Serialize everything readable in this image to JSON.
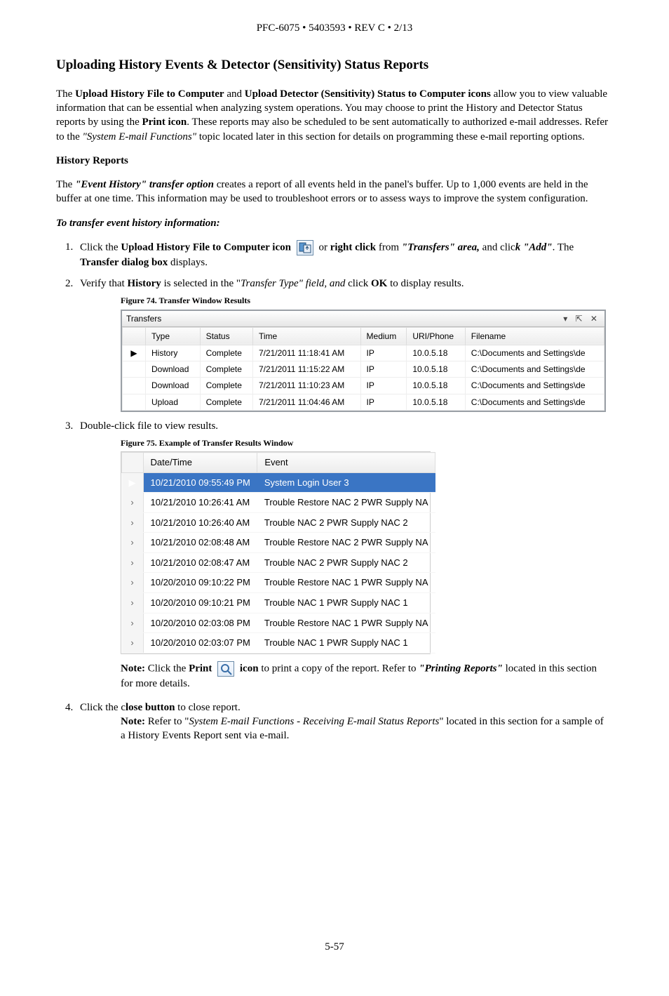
{
  "header_line": "PFC-6075 • 5403593 • REV C • 2/13",
  "title": "Uploading History Events & Detector (Sensitivity) Status Reports",
  "intro": {
    "p1_a": "The ",
    "p1_b": "Upload History File to Computer",
    "p1_c": " and ",
    "p1_d": "Upload Detector (Sensitivity) Status to Computer icons",
    "p1_e": " allow you to view valuable information that can be essential when analyzing system operations. You may choose to print the History and Detector Status reports by using the ",
    "p1_f": "Print icon",
    "p1_g": ". These reports may also be scheduled to be sent automatically to authorized e-mail addresses. Refer to the ",
    "p1_h": "\"System E-mail Functions\"",
    "p1_i": " topic located later in this section for details on programming these e-mail reporting options."
  },
  "history_heading": "History Reports",
  "hist_p": {
    "a": "The ",
    "b": "\"Event History\" transfer option",
    "c": " creates a report of all events held in the panel's buffer. Up to 1,000 events are held in the buffer at one time. This information may be used to troubleshoot errors or to assess ways to improve the system configuration."
  },
  "transfer_heading": "To transfer event history information:",
  "step1": {
    "a": "Click the ",
    "b": "Upload History File to Computer icon",
    "c": "  or ",
    "d": "right click",
    "e": " from ",
    "f": "\"Transfers\" area,",
    "g": " and clic",
    "h": "k \"Add\"",
    "i": ". The ",
    "j": "Transfer dialog box",
    "k": " displays."
  },
  "step2": {
    "a": "Verify that ",
    "b": "History",
    "c": " is selected  in the \"",
    "d": "Transfer Type\" field, and ",
    "e": "click ",
    "f": "OK",
    "g": " to display results."
  },
  "fig74": "Figure 74. Transfer Window Results",
  "transfers": {
    "title": "Transfers",
    "headers": {
      "type": "Type",
      "status": "Status",
      "time": "Time",
      "medium": "Medium",
      "uri": "URI/Phone",
      "file": "Filename"
    },
    "rows": [
      {
        "ptr": "▶",
        "type": "History",
        "status": "Complete",
        "time": "7/21/2011 11:18:41 AM",
        "medium": "IP",
        "uri": "10.0.5.18",
        "file": "C:\\Documents and Settings\\de"
      },
      {
        "ptr": "",
        "type": "Download",
        "status": "Complete",
        "time": "7/21/2011 11:15:22 AM",
        "medium": "IP",
        "uri": "10.0.5.18",
        "file": "C:\\Documents and Settings\\de"
      },
      {
        "ptr": "",
        "type": "Download",
        "status": "Complete",
        "time": "7/21/2011 11:10:23 AM",
        "medium": "IP",
        "uri": "10.0.5.18",
        "file": "C:\\Documents and Settings\\de"
      },
      {
        "ptr": "",
        "type": "Upload",
        "status": "Complete",
        "time": "7/21/2011 11:04:46 AM",
        "medium": "IP",
        "uri": "10.0.5.18",
        "file": "C:\\Documents and Settings\\de"
      }
    ]
  },
  "step3": "Double-click file to view results.",
  "fig75": "Figure 75. Example of Transfer Results Window",
  "results": {
    "headers": {
      "dt": "Date/Time",
      "ev": "Event"
    },
    "rows": [
      {
        "sel": true,
        "dt": "10/21/2010 09:55:49 PM",
        "ev": "System Login User 3"
      },
      {
        "sel": false,
        "dt": "10/21/2010 10:26:41 AM",
        "ev": "Trouble Restore NAC 2 PWR Supply NA"
      },
      {
        "sel": false,
        "dt": "10/21/2010 10:26:40 AM",
        "ev": "Trouble NAC 2 PWR Supply NAC 2"
      },
      {
        "sel": false,
        "dt": "10/21/2010 02:08:48 AM",
        "ev": "Trouble Restore NAC 2 PWR Supply NA"
      },
      {
        "sel": false,
        "dt": "10/21/2010 02:08:47 AM",
        "ev": "Trouble NAC 2 PWR Supply NAC 2"
      },
      {
        "sel": false,
        "dt": "10/20/2010 09:10:22 PM",
        "ev": "Trouble Restore NAC 1 PWR Supply NA"
      },
      {
        "sel": false,
        "dt": "10/20/2010 09:10:21 PM",
        "ev": "Trouble NAC 1 PWR Supply NAC 1"
      },
      {
        "sel": false,
        "dt": "10/20/2010 02:03:08 PM",
        "ev": "Trouble Restore NAC 1 PWR Supply NA"
      },
      {
        "sel": false,
        "dt": "10/20/2010 02:03:07 PM",
        "ev": "Trouble NAC 1 PWR Supply NAC 1"
      }
    ]
  },
  "note1": {
    "a": "Note:",
    "b": " Click the ",
    "c": "Print",
    "d": "icon",
    "e": " to print a copy of the report. Refer to ",
    "f": "\"Printing Reports\"",
    "g": " located in this section for more details."
  },
  "step4": {
    "a": "Click the c",
    "b": "lose button",
    "c": " to close report."
  },
  "note2": {
    "a": "Note:",
    "b": " Refer to \"",
    "c": "System E-mail Functions - Receiving E-mail Status Reports",
    "d": "\" located in this section for a sample of a History Events Report sent via e-mail."
  },
  "page_number": "5-57"
}
